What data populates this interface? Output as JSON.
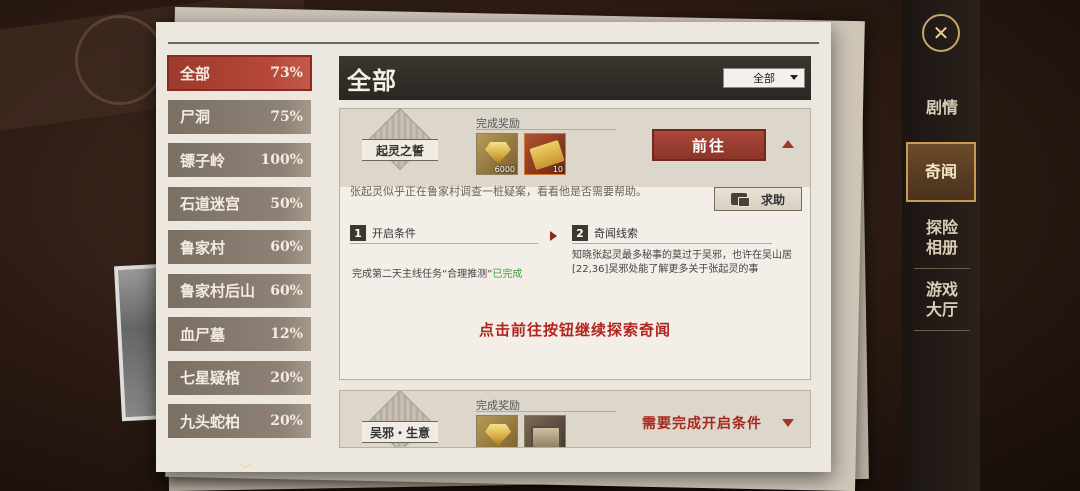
{
  "categories": [
    {
      "name": "全部",
      "pct": "73%",
      "active": true
    },
    {
      "name": "尸洞",
      "pct": "75%"
    },
    {
      "name": "镖子岭",
      "pct": "100%"
    },
    {
      "name": "石道迷宫",
      "pct": "50%"
    },
    {
      "name": "鲁家村",
      "pct": "60%"
    },
    {
      "name": "鲁家村后山",
      "pct": "60%"
    },
    {
      "name": "血尸墓",
      "pct": "12%"
    },
    {
      "name": "七星疑棺",
      "pct": "20%"
    },
    {
      "name": "九头蛇柏",
      "pct": "20%"
    }
  ],
  "more_glyph": "﹀",
  "main": {
    "title": "全部",
    "filter": "全部"
  },
  "card1": {
    "emblem": "起灵之誓",
    "reward_label": "完成奖励",
    "rewards": [
      {
        "type": "gem",
        "count": "6000"
      },
      {
        "type": "ticket",
        "count": "10"
      }
    ],
    "go_button": "前往",
    "description": "张起灵似乎正在鲁家村调查一桩疑案，看看他是否需要帮助。",
    "help_button": "求助",
    "step1": {
      "num": "1",
      "title": "开启条件"
    },
    "step2": {
      "num": "2",
      "title": "奇闻线索"
    },
    "condition": "完成第二天主线任务“合理推测”",
    "condition_status": "已完成",
    "clue": "知晓张起灵最多秘事的莫过于吴邪，也许在吴山居[22,36]吴邪处能了解更多关于张起灵的事",
    "hint": "点击前往按钮继续探索奇闻"
  },
  "card2": {
    "emblem": "吴邪・生意",
    "reward_label": "完成奖励",
    "rewards": [
      {
        "type": "gem",
        "count": ""
      },
      {
        "type": "chest",
        "count": ""
      }
    ],
    "requirement": "需要完成开启条件"
  },
  "sidebar": {
    "logo_glyph": "✕",
    "items": [
      {
        "label": "剧情"
      },
      {
        "label": "奇闻",
        "active": true
      },
      {
        "label": "探险相册"
      },
      {
        "label": "游戏大厅"
      }
    ]
  },
  "colors": {
    "active_red": "#b6483a",
    "accent_red": "#b0261e",
    "done_green": "#3f9a3f",
    "gold": "#c79a55"
  }
}
